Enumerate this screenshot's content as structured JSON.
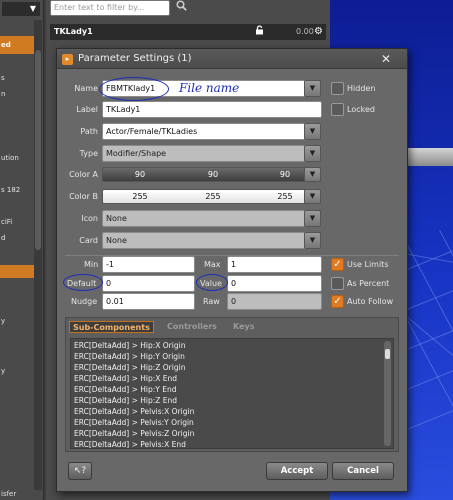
{
  "left_panel": {
    "dropdown_glyph": "▼",
    "items": [
      "ed",
      "s",
      "n",
      "ution",
      "s 182",
      "ciFi",
      "d",
      "y",
      "y",
      "isfer"
    ]
  },
  "top_bar": {
    "filter_placeholder": "Enter text to filter by...",
    "search_icon": "search-icon"
  },
  "scene_row": {
    "name": "TKLady1",
    "value": "0.00"
  },
  "dialog": {
    "title": "Parameter Settings (1)",
    "name": {
      "label": "Name",
      "value": "FBMTKlady1"
    },
    "label": {
      "label": "Label",
      "value": "TKLady1"
    },
    "path": {
      "label": "Path",
      "value": "Actor/Female/TKLadies"
    },
    "type": {
      "label": "Type",
      "value": "Modifier/Shape"
    },
    "color_a": {
      "label": "Color A",
      "values": [
        "90",
        "90",
        "90"
      ]
    },
    "color_b": {
      "label": "Color B",
      "values": [
        "255",
        "255",
        "255"
      ]
    },
    "icon": {
      "label": "Icon",
      "value": "None"
    },
    "card": {
      "label": "Card",
      "value": "None"
    },
    "hidden_label": "Hidden",
    "hidden_checked": false,
    "locked_label": "Locked",
    "locked_checked": false,
    "min": {
      "label": "Min",
      "value": "-1"
    },
    "max": {
      "label": "Max",
      "value": "1"
    },
    "default": {
      "label": "Default",
      "value": "0"
    },
    "value": {
      "label": "Value",
      "value": "0"
    },
    "nudge": {
      "label": "Nudge",
      "value": "0.01"
    },
    "raw": {
      "label": "Raw",
      "value": "0"
    },
    "use_limits_label": "Use Limits",
    "use_limits_checked": true,
    "as_percent_label": "As Percent",
    "as_percent_checked": false,
    "auto_follow_label": "Auto Follow",
    "auto_follow_checked": true,
    "tabs": [
      "Sub-Components",
      "Controllers",
      "Keys"
    ],
    "active_tab": "Sub-Components",
    "sub_components": [
      "ERC[DeltaAdd] > Hip:X Origin",
      "ERC[DeltaAdd] > Hip:Y Origin",
      "ERC[DeltaAdd] > Hip:Z Origin",
      "ERC[DeltaAdd] > Hip:X End",
      "ERC[DeltaAdd] > Hip:Y End",
      "ERC[DeltaAdd] > Hip:Z End",
      "ERC[DeltaAdd] > Pelvis:X Origin",
      "ERC[DeltaAdd] > Pelvis:Y Origin",
      "ERC[DeltaAdd] > Pelvis:Z Origin",
      "ERC[DeltaAdd] > Pelvis:X End"
    ],
    "help_label": "?",
    "accept_label": "Accept",
    "cancel_label": "Cancel",
    "close_glyph": "✕"
  },
  "annotation": {
    "text": "File name",
    "color": "#1c2fb8"
  },
  "colors": {
    "accent": "#e07b21",
    "viewport": "#1734c4"
  }
}
